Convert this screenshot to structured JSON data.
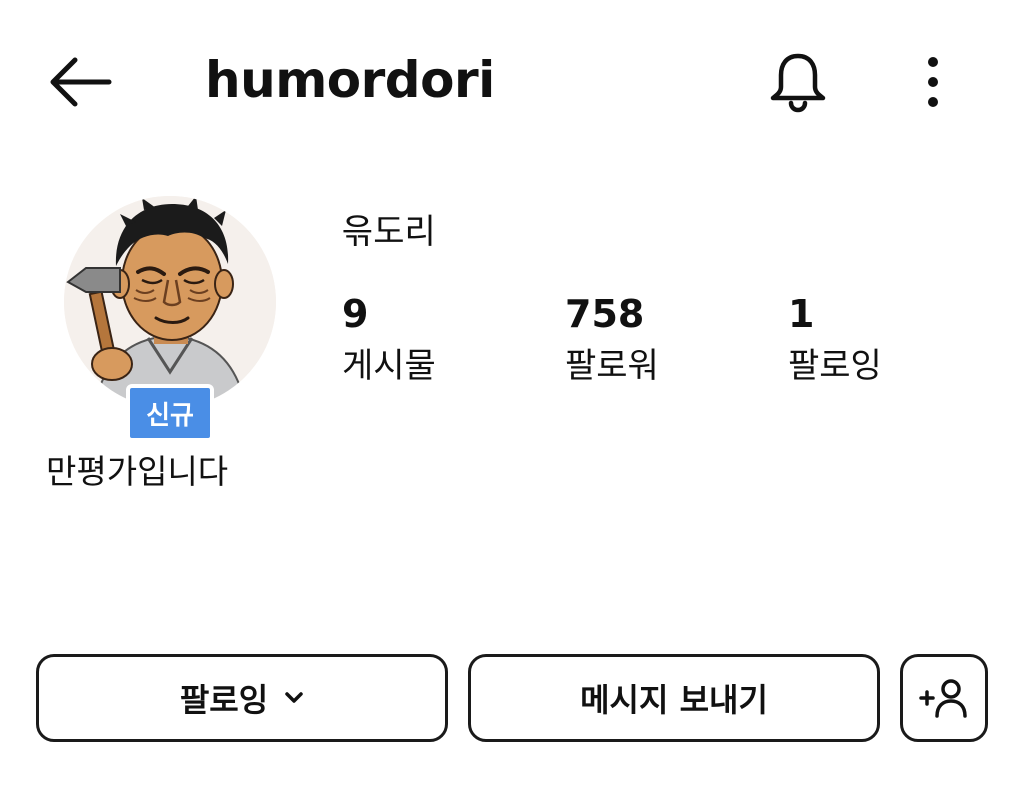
{
  "header": {
    "username": "humordori",
    "back_icon": "arrow-left-icon",
    "notification_icon": "bell-icon",
    "more_icon": "more-vertical-icon"
  },
  "profile": {
    "display_name": "윾도리",
    "badge": "신규",
    "bio": "만평가입니다",
    "avatar": "cartoon-old-man-with-hammer"
  },
  "stats": [
    {
      "value": "9",
      "label": "게시물"
    },
    {
      "value": "758",
      "label": "팔로워"
    },
    {
      "value": "1",
      "label": "팔로잉"
    }
  ],
  "actions": {
    "follow_label": "팔로잉",
    "message_label": "메시지 보내기",
    "add_user_icon": "add-user-icon"
  },
  "colors": {
    "badge_bg": "#4a8ee6",
    "text": "#111111",
    "border": "#1a1a1a"
  }
}
